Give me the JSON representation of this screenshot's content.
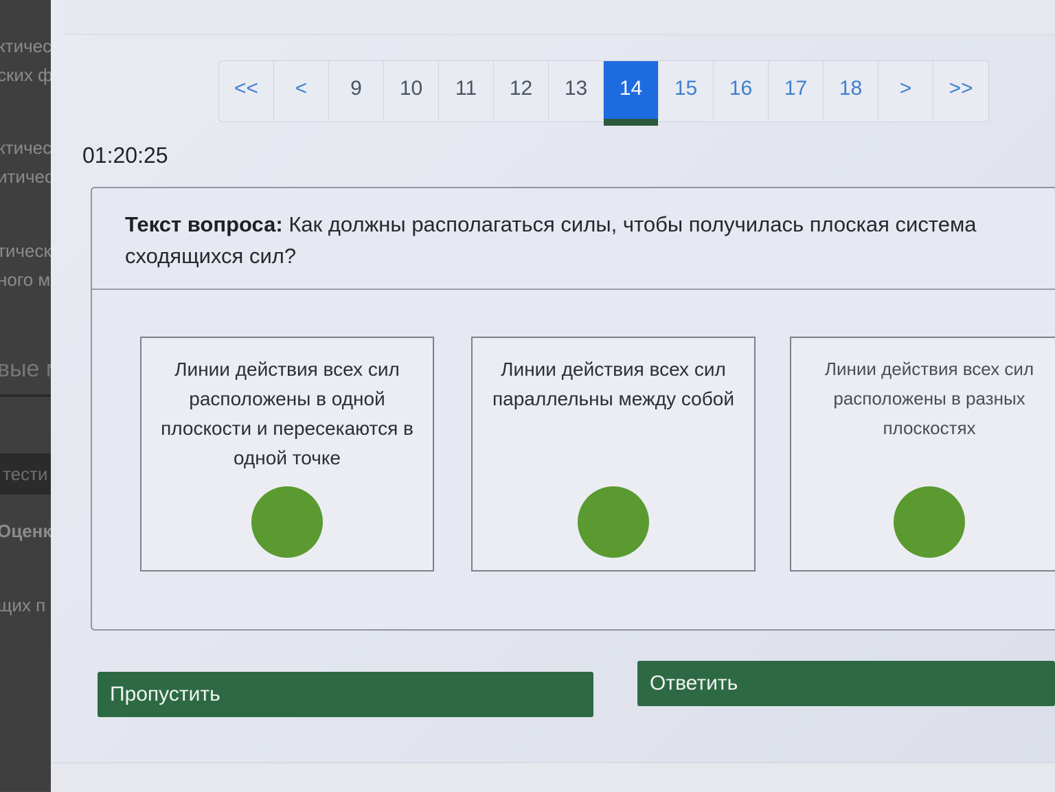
{
  "sidebar": {
    "fragments": [
      "ктическ",
      "ских фи",
      "ктическ",
      "итичес",
      "тическ",
      "ного м",
      "вые м",
      "тести",
      "Оценк",
      "щих п"
    ]
  },
  "pagination": {
    "items": [
      "<<",
      "<",
      "9",
      "10",
      "11",
      "12",
      "13",
      "14",
      "15",
      "16",
      "17",
      "18",
      ">",
      ">>"
    ],
    "current": "14"
  },
  "timer": "01:20:25",
  "question": {
    "label": "Текст вопроса:",
    "text": "Как должны располагаться силы, чтобы получилась плоская система сходящихся сил?"
  },
  "options": [
    {
      "text": "Линии действия всех сил расположены в одной плоскости и пересекаются в одной точке",
      "selected": false
    },
    {
      "text": "Линии действия всех сил параллельны между собой",
      "selected": false
    },
    {
      "text": "Линии действия всех сил расположены в разных плоскостях",
      "selected": false
    }
  ],
  "colors": {
    "accent": "#1e6be0",
    "button": "#2d6a43",
    "option_marker": "#5a9a30"
  },
  "buttons": {
    "skip": "Пропустить",
    "answer": "Ответить"
  }
}
